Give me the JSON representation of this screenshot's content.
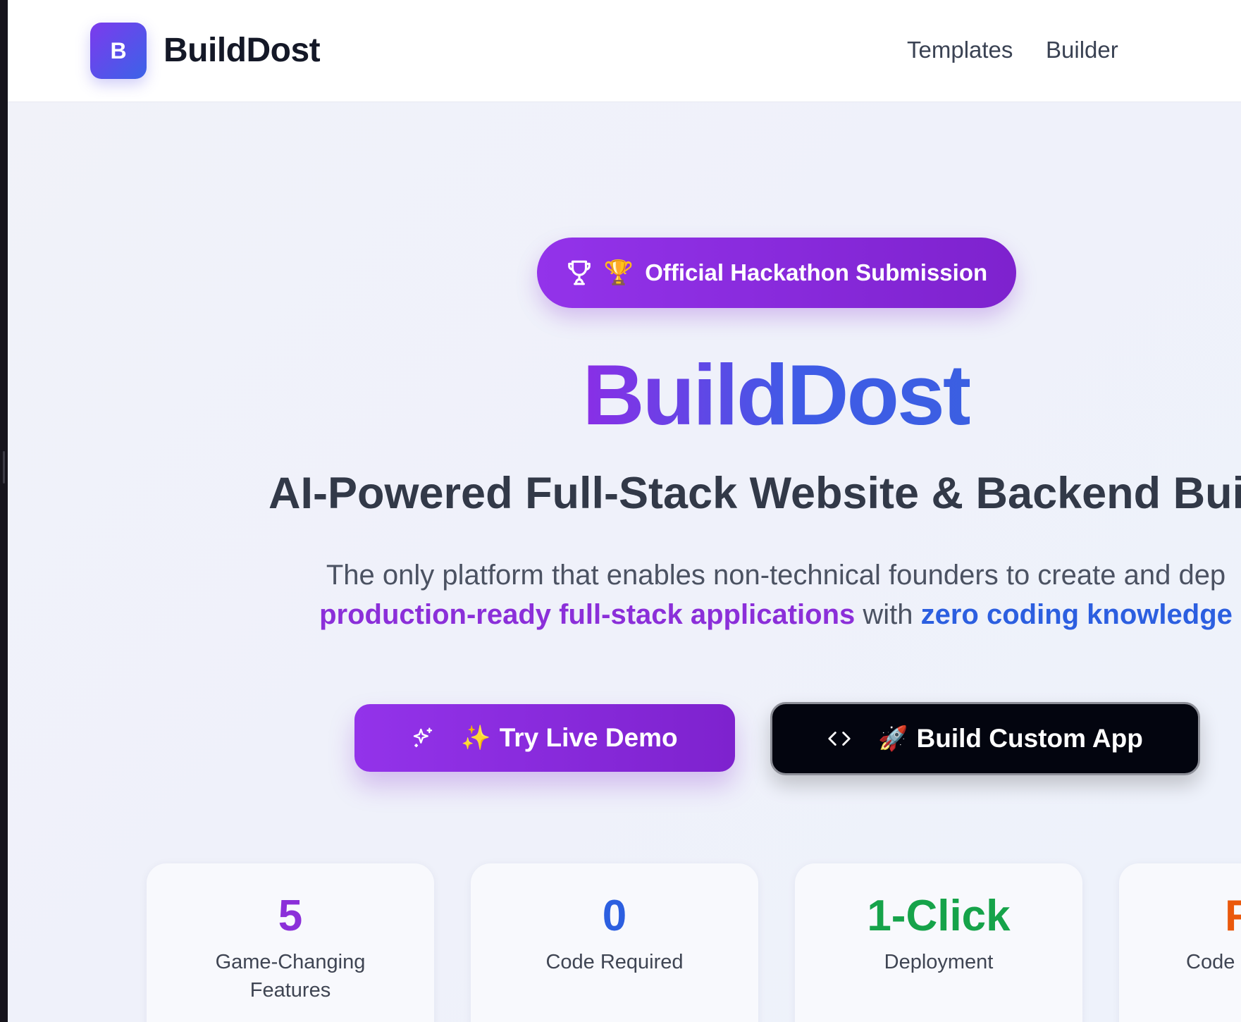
{
  "header": {
    "logo_letter": "B",
    "brand": "BuildDost",
    "nav": [
      {
        "label": "Templates"
      },
      {
        "label": "Builder"
      }
    ]
  },
  "hero": {
    "badge": {
      "icon": "trophy-icon",
      "emoji": "🏆",
      "label": "Official Hackathon Submission"
    },
    "title": "BuildDost",
    "subtitle": "AI-Powered Full-Stack Website & Backend Build",
    "description": {
      "line1": "The only platform that enables non-technical founders to create and dep",
      "highlight1": "production-ready full-stack applications",
      "connector": " with ",
      "highlight2": "zero coding knowledge"
    }
  },
  "actions": {
    "demo": {
      "icon": "sparkles-icon",
      "emoji": "✨",
      "label": "Try Live Demo"
    },
    "build": {
      "icon": "code-icon",
      "emoji": "🚀",
      "label": "Build Custom App"
    }
  },
  "stats": [
    {
      "value": "5",
      "label_lines": [
        "Game-Changing",
        "Features"
      ],
      "color": "#8b2fd9"
    },
    {
      "value": "0",
      "label_lines": [
        "Code Required"
      ],
      "color": "#2c5fe0"
    },
    {
      "value": "1-Click",
      "label_lines": [
        "Deployment"
      ],
      "color": "#16a34a"
    },
    {
      "value": "F",
      "label_lines": [
        "Code"
      ],
      "color": "#ea580c"
    }
  ],
  "colors": {
    "brand_purple": "#9333ea",
    "brand_blue": "#3b63e8",
    "dark_button": "#03050f"
  }
}
